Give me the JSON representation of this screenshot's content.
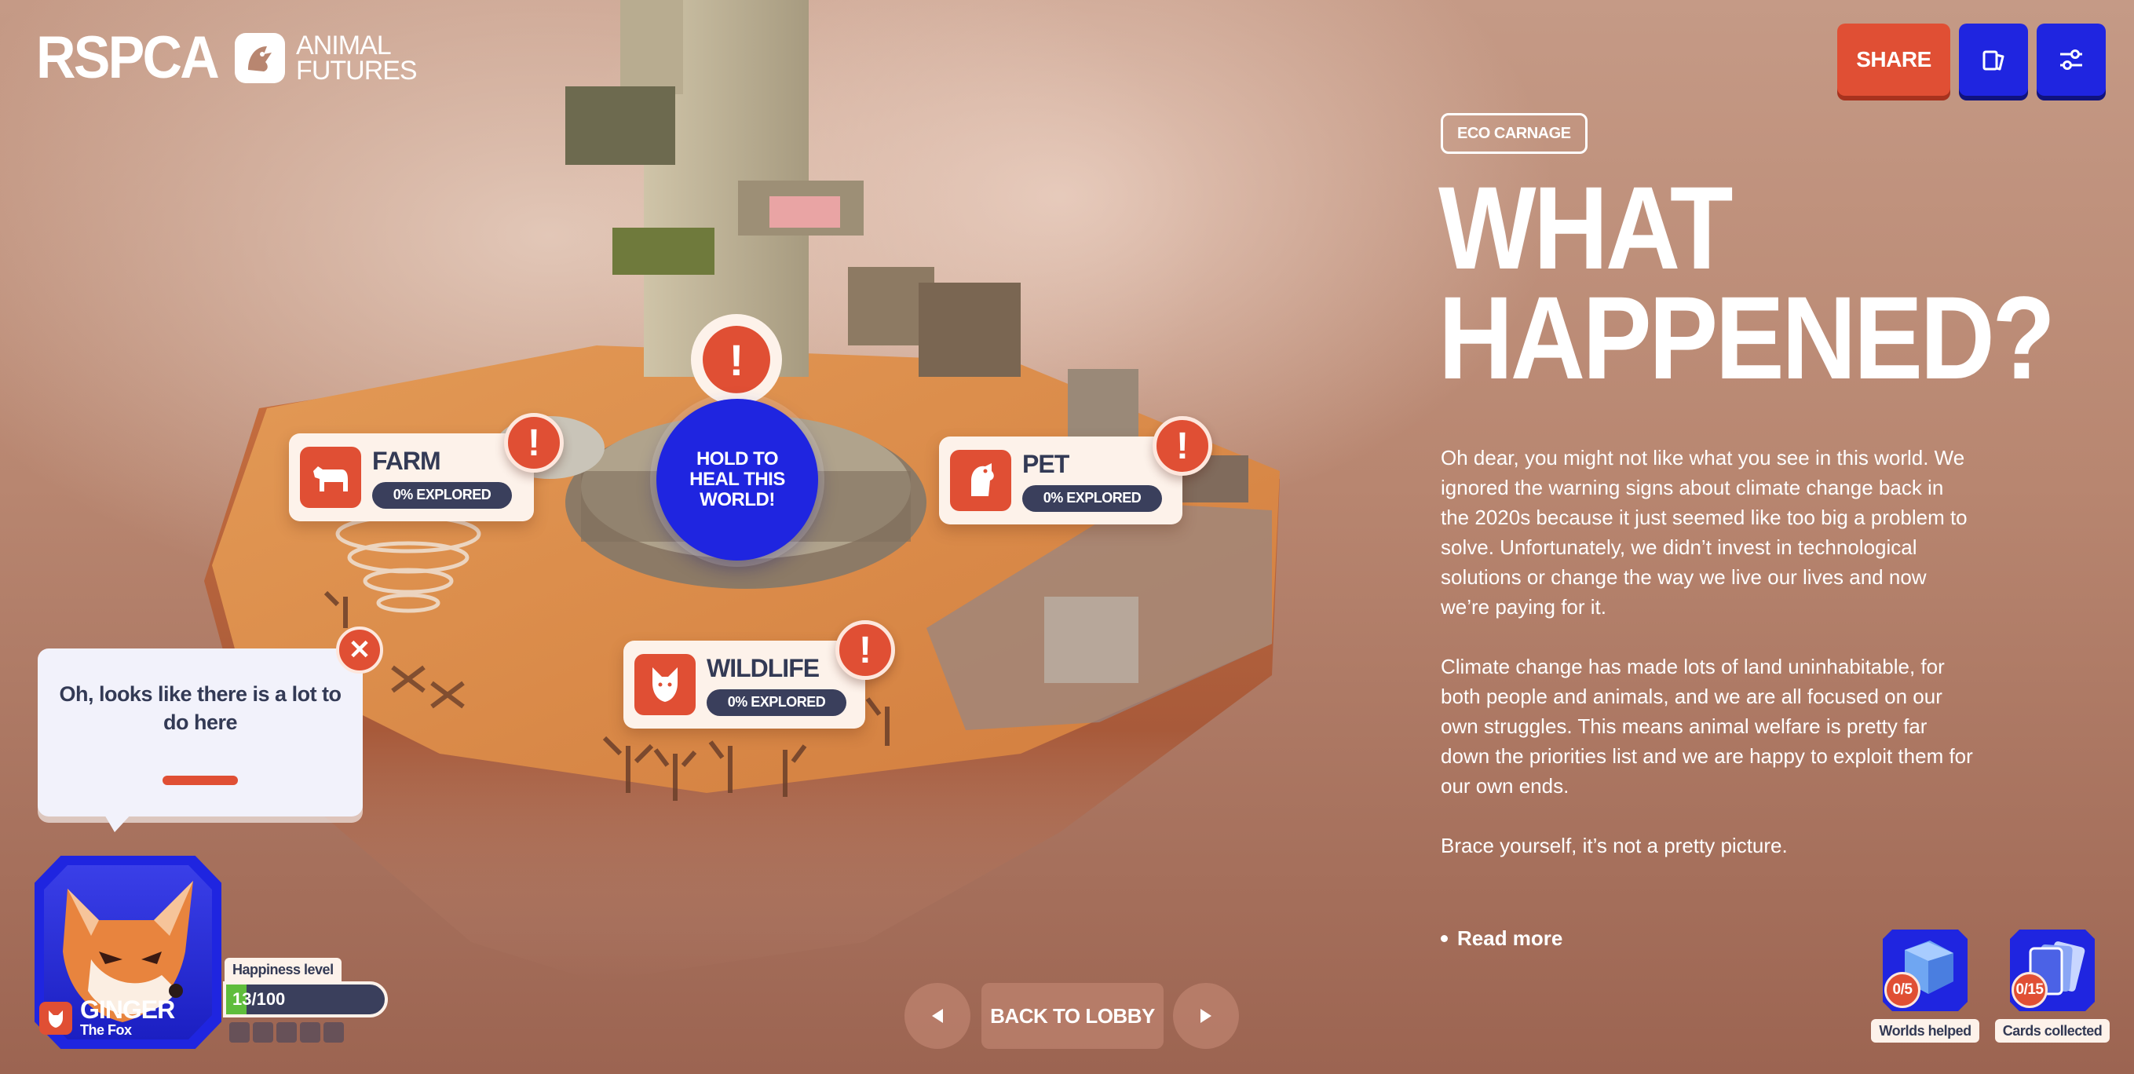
{
  "brand": {
    "name": "RSPCA",
    "tagline_line1": "ANIMAL",
    "tagline_line2": "FUTURES"
  },
  "header": {
    "share_label": "SHARE",
    "cards_icon": "cards-icon",
    "settings_icon": "sliders-icon"
  },
  "panel": {
    "tag": "ECO CARNAGE",
    "title_line1": "WHAT",
    "title_line2": "HAPPENED?",
    "paragraphs": [
      "Oh dear, you might not like what you see in this world. We ignored the warning signs about climate change back in the 2020s because it just seemed like too big a problem to solve. Unfortunately, we didn’t invest in technological solutions or change the way we live our lives and now we’re paying for it.",
      "Climate change has made lots of land uninhabitable, for both people and animals, and we are all focused on our own struggles. This means animal welfare is pretty far down the priorities list and we are happy to exploit them for our own ends.",
      "Brace yourself, it’s not a pretty picture."
    ],
    "read_more": "Read more"
  },
  "locations": {
    "farm": {
      "name": "FARM",
      "progress": "0% EXPLORED",
      "icon": "cow-icon",
      "alert": "!"
    },
    "pet": {
      "name": "PET",
      "progress": "0% EXPLORED",
      "icon": "dog-icon",
      "alert": "!"
    },
    "wildlife": {
      "name": "WILDLIFE",
      "progress": "0% EXPLORED",
      "icon": "fox-icon",
      "alert": "!"
    }
  },
  "hold": {
    "label": "HOLD TO HEAL THIS WORLD!",
    "alert": "!"
  },
  "speech": {
    "text": "Oh, looks like there is a lot to do here",
    "close": "✕"
  },
  "character": {
    "name": "GINGER",
    "species": "The Fox",
    "happiness_label": "Happiness level",
    "happiness_text": "13/100",
    "happiness_value": 13,
    "happiness_max": 100
  },
  "nav": {
    "back_label": "BACK TO LOBBY",
    "prev_icon": "triangle-left-icon",
    "next_icon": "triangle-right-icon"
  },
  "stats": {
    "worlds": {
      "count": "0/5",
      "label": "Worlds helped"
    },
    "cards": {
      "count": "0/15",
      "label": "Cards collected"
    }
  },
  "colors": {
    "accent": "#e04f34",
    "primary": "#1f25e0",
    "dark": "#3a3f5c",
    "cream": "#fdf2ea"
  }
}
